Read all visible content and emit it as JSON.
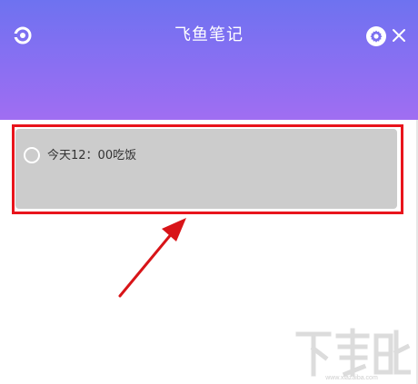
{
  "app": {
    "title": "飞鱼笔记"
  },
  "header": {
    "logo_icon": "refresh-circle-icon",
    "settings_icon": "gear-icon",
    "close_icon": "close-icon",
    "gradient_top": "#6e72f0",
    "gradient_bottom": "#a06ef2"
  },
  "notes": [
    {
      "text": "今天12：00吃饭",
      "checked": false
    }
  ],
  "annotation": {
    "box_color": "#e8141c",
    "arrow_color": "#e8141c"
  },
  "watermark": {
    "text": "下载吧"
  }
}
